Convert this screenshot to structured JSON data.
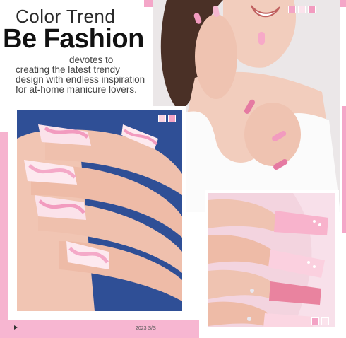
{
  "header": {
    "kicker": "Color Trend",
    "headline": "Be Fashion",
    "blurb_line1": "devotes to",
    "blurb_rest": "creating the latest trendy design with endless inspiration for at-home manicure lovers."
  },
  "footer": {
    "season": "2023 S/S"
  },
  "colors": {
    "accent_pink": "#f4a6c8",
    "swatch_light": "#f9d2e1",
    "swatch_mid": "#f3a3c5",
    "swatch_pale": "#fbe3ec"
  },
  "icons": {
    "play": "play-icon"
  }
}
